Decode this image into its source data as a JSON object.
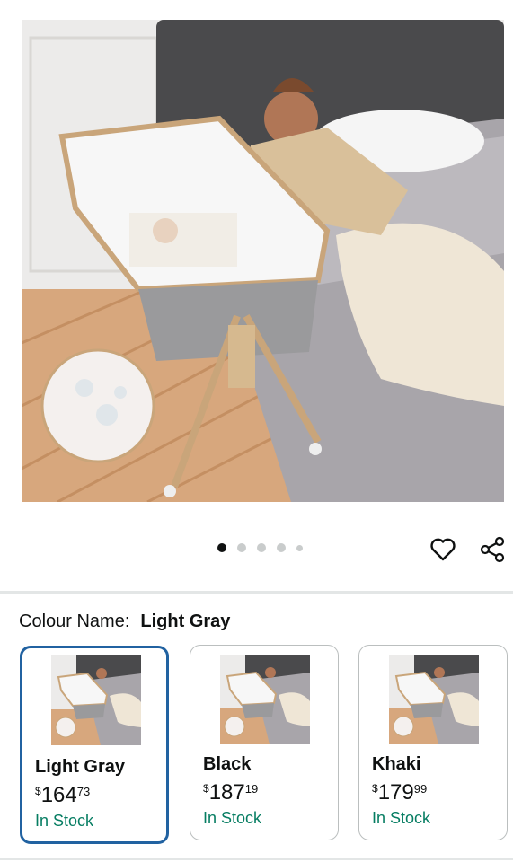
{
  "image_gallery": {
    "page_count": 5,
    "active_page": 1,
    "wishlist_icon": "heart-icon",
    "share_icon": "share-icon"
  },
  "variant": {
    "label": "Colour Name:",
    "selected": "Light Gray"
  },
  "swatches": [
    {
      "name": "Light Gray",
      "currency": "$",
      "whole": "164",
      "fraction": "73",
      "stock": "In Stock"
    },
    {
      "name": "Black",
      "currency": "$",
      "whole": "187",
      "fraction": "19",
      "stock": "In Stock"
    },
    {
      "name": "Khaki",
      "currency": "$",
      "whole": "179",
      "fraction": "99",
      "stock": "In Stock"
    }
  ],
  "colors": {
    "accent_border": "#2162a1",
    "in_stock": "#067d62",
    "dot_active": "#0f1111",
    "dot_inactive": "#c9cccc"
  }
}
